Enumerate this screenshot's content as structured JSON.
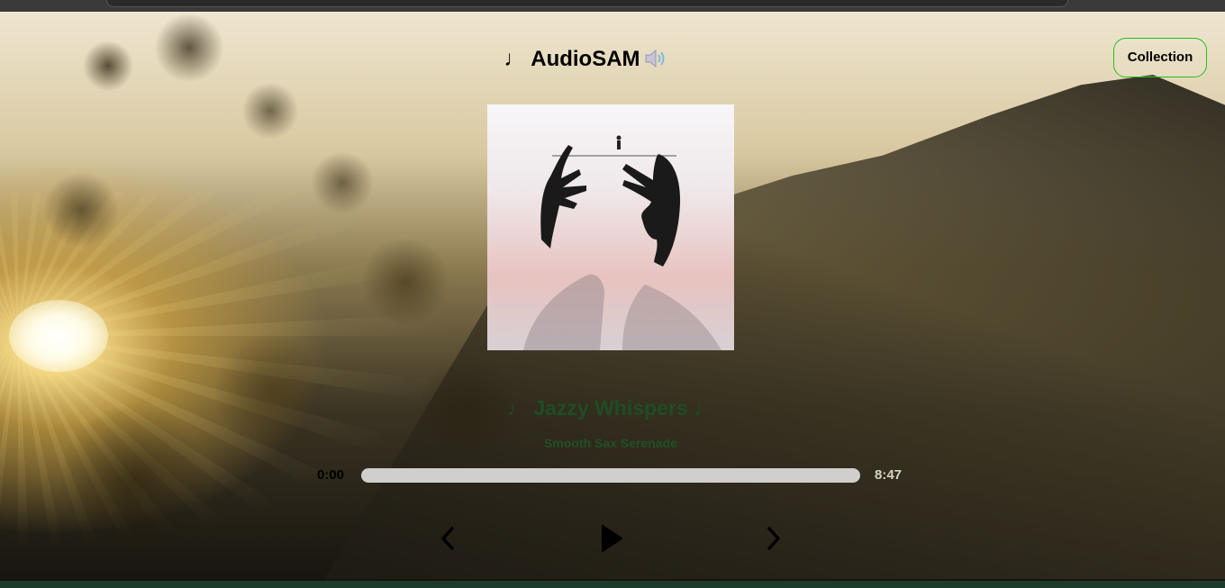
{
  "app": {
    "title": "♩ AudioSAM",
    "collection_label": "Collection"
  },
  "track": {
    "title": "♩ Jazzy Whispers ♩",
    "artist": "Smooth Sax Serenade"
  },
  "player": {
    "current_time": "0:00",
    "total_time": "8:47",
    "progress_fraction": 0.0
  },
  "icons": {
    "speaker": "speaker-icon",
    "previous": "chevron-left-icon",
    "play": "play-icon",
    "next": "chevron-right-icon"
  },
  "colors": {
    "accent_border": "#22c022",
    "track_title": "#1f4d23",
    "progress_track": "#d0cfcd"
  }
}
